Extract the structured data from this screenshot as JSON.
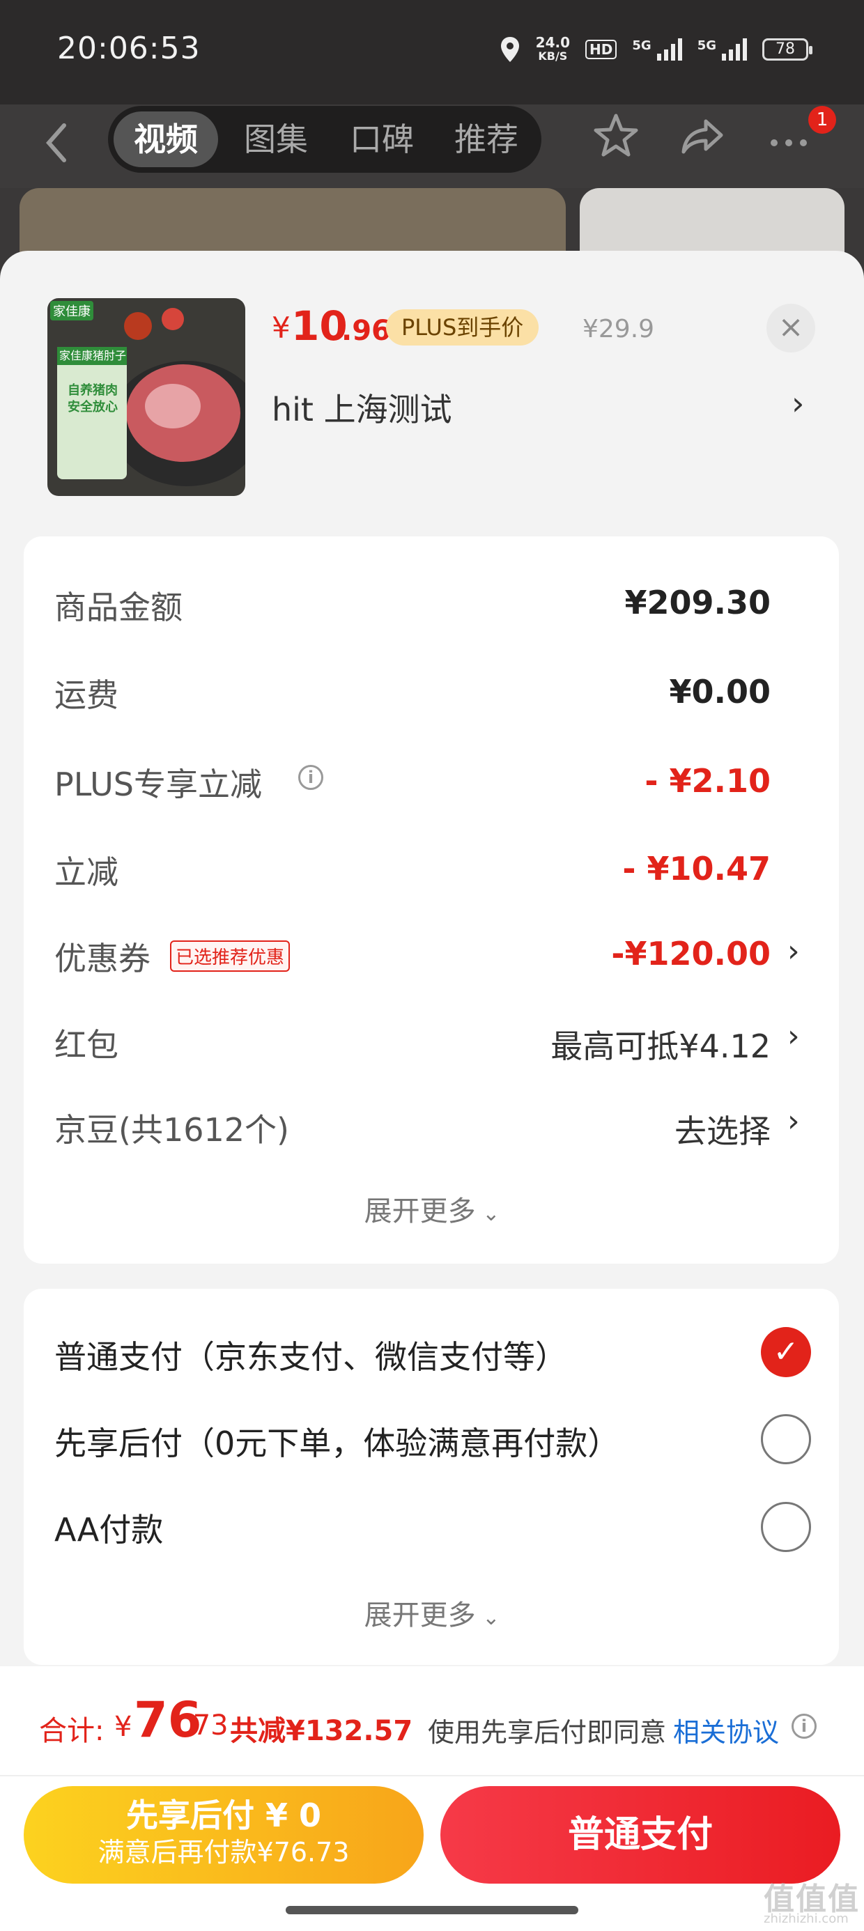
{
  "status_bar": {
    "time": "20:06:53",
    "net_speed": "24.0",
    "net_unit": "KB/S",
    "hd": "HD",
    "sig1": "5G",
    "sig2": "5G",
    "battery": "78"
  },
  "nav": {
    "tabs": [
      "视频",
      "图集",
      "口碑",
      "推荐"
    ],
    "active_tab": "视频",
    "badge": "1"
  },
  "product": {
    "currency": "¥",
    "price_int": "10",
    "price_dec": ".96",
    "plus_label": "PLUS到手价",
    "original_price": "¥29.9",
    "address": "hit  上海测试",
    "thumb_brand": "家佳康",
    "thumb_line1": "家佳康猪肘子",
    "thumb_line2": "自养猪肉",
    "thumb_line3": "安全放心"
  },
  "summary": {
    "rows": [
      {
        "label": "商品金额",
        "value": "¥209.30"
      },
      {
        "label": "运费",
        "value": "¥0.00"
      },
      {
        "label": "PLUS专享立减",
        "value": "- ¥2.10"
      },
      {
        "label": "立减",
        "value": "- ¥10.47"
      },
      {
        "label": "优惠券",
        "tag": "已选推荐优惠",
        "value": "-¥120.00"
      },
      {
        "label": "红包",
        "value": "最高可抵¥4.12"
      },
      {
        "label": "京豆(共1612个)",
        "value": "去选择"
      }
    ],
    "expand_label": "展开更多"
  },
  "payment": {
    "options": [
      {
        "label": "普通支付（京东支付、微信支付等）",
        "selected": true
      },
      {
        "label": "先享后付（0元下单，体验满意再付款）",
        "selected": false
      },
      {
        "label": "AA付款",
        "selected": false
      }
    ],
    "expand_label": "展开更多"
  },
  "footer": {
    "total_label": "合计:",
    "currency": "¥",
    "total_int": "76",
    "total_dec": ".73",
    "saved": "共减¥132.57",
    "agree_text": "使用先享后付即同意",
    "agree_link": "相关协议",
    "bnpl_title": "先享后付 ¥ 0",
    "bnpl_sub": "满意后再付款¥76.73",
    "pay_label": "普通支付"
  },
  "watermark": {
    "main": "值值值",
    "sub": "zhizhizhi.com"
  },
  "colors": {
    "accent": "#e2231a",
    "plus_badge": "#fbe0a6",
    "link": "#1a6ed6"
  }
}
